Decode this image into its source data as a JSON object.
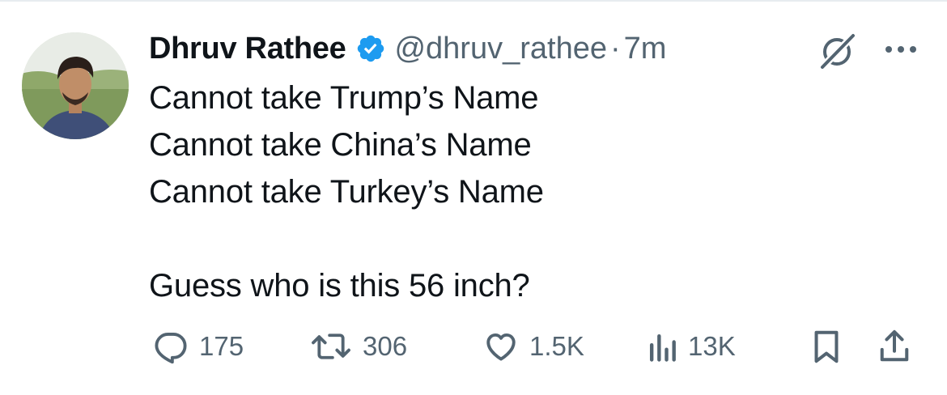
{
  "tweet": {
    "author_name": "Dhruv Rathee",
    "handle": "@dhruv_rathee",
    "separator": "·",
    "time": "7m",
    "verified": true,
    "lines": [
      "Cannot take Trump’s Name",
      "Cannot take China’s Name",
      "Cannot take Turkey’s Name",
      "",
      "Guess who is this 56 inch?"
    ]
  },
  "actions": {
    "replies": "175",
    "reposts": "306",
    "likes": "1.5K",
    "views": "13K"
  },
  "icons": {
    "verified": "verified-badge-icon",
    "grok": "grok-icon",
    "more": "more-icon",
    "reply": "reply-icon",
    "repost": "repost-icon",
    "like": "heart-icon",
    "views": "views-icon",
    "bookmark": "bookmark-icon",
    "share": "share-icon"
  },
  "colors": {
    "accent": "#1d9bf0",
    "text": "#0f1419",
    "secondary": "#536471"
  }
}
